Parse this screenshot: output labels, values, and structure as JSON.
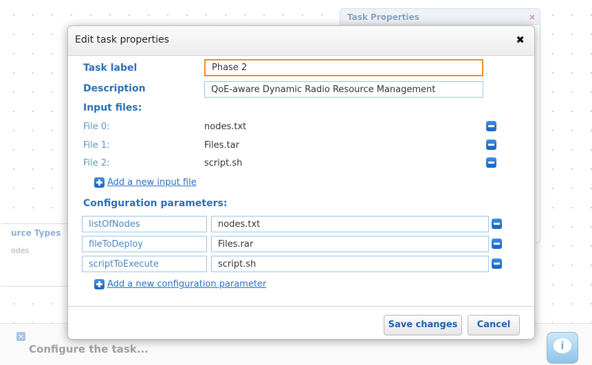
{
  "background": {
    "task_properties_title": "Task Properties",
    "task_properties_close": "×",
    "resource_types_title": "urce Types",
    "resource_types_item": "odes",
    "configure_text": "Configure the task...",
    "configure_close": "×",
    "info_icon": "i"
  },
  "dialog": {
    "title": "Edit task properties",
    "close_symbol": "✖",
    "task_label": {
      "label": "Task label",
      "value": "Phase 2"
    },
    "description": {
      "label": "Description",
      "value": "QoE-aware Dynamic Radio Resource Management"
    },
    "input_files_heading": "Input files:",
    "input_files": [
      {
        "label": "File 0:",
        "value": "nodes.txt"
      },
      {
        "label": "File 1:",
        "value": "Files.tar"
      },
      {
        "label": "File 2:",
        "value": "script.sh"
      }
    ],
    "add_input_file": "Add a new input file",
    "config_heading": "Configuration parameters:",
    "config_params": [
      {
        "name": "listOfNodes",
        "value": "nodes.txt"
      },
      {
        "name": "fileToDeploy",
        "value": "Files.rar"
      },
      {
        "name": "scriptToExecute",
        "value": "script.sh"
      }
    ],
    "add_config_param": "Add a new configuration parameter",
    "save_label": "Save changes",
    "cancel_label": "Cancel"
  },
  "colors": {
    "accent": "#2c6fb6",
    "focus_border": "#f28a1e",
    "input_border": "#9cc4e4"
  }
}
